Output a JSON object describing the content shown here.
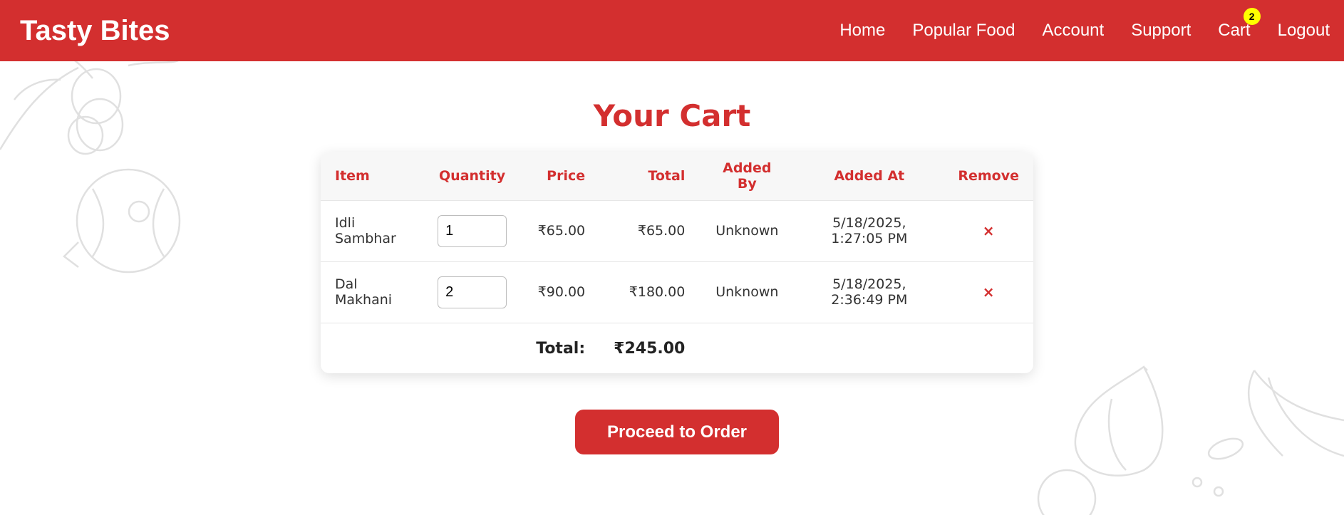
{
  "brand": "Tasty Bites",
  "nav": {
    "home": "Home",
    "popular_food": "Popular Food",
    "account": "Account",
    "support": "Support",
    "cart": "Cart",
    "cart_count": "2",
    "logout": "Logout"
  },
  "page_title": "Your Cart",
  "table": {
    "headers": {
      "item": "Item",
      "quantity": "Quantity",
      "price": "Price",
      "total": "Total",
      "added_by": "Added By",
      "added_at": "Added At",
      "remove": "Remove"
    },
    "rows": [
      {
        "item": "Idli Sambhar",
        "quantity": "1",
        "price": "₹65.00",
        "total": "₹65.00",
        "added_by": "Unknown",
        "added_at": "5/18/2025, 1:27:05 PM",
        "remove": "×"
      },
      {
        "item": "Dal Makhani",
        "quantity": "2",
        "price": "₹90.00",
        "total": "₹180.00",
        "added_by": "Unknown",
        "added_at": "5/18/2025, 2:36:49 PM",
        "remove": "×"
      }
    ],
    "footer": {
      "label": "Total:",
      "value": "₹245.00"
    }
  },
  "order_button": "Proceed to Order",
  "colors": {
    "brand_red": "#d32f2f",
    "badge_yellow": "#ffff00",
    "doodle_gray": "#dddddd"
  },
  "icons": {
    "remove": "close-icon",
    "background": "vegetable-doodle-illustrations"
  }
}
